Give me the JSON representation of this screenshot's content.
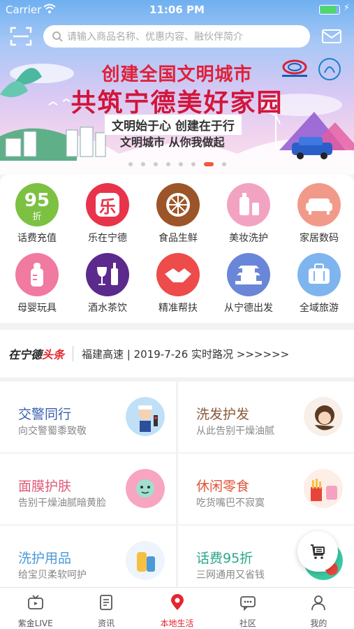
{
  "status_bar": {
    "carrier": "Carrier",
    "time": "11:06 PM",
    "battery_level": 0.85
  },
  "search": {
    "placeholder": "请输入商品名称、优惠内容、融伙伴简介"
  },
  "banner": {
    "title_line1": "创建全国文明城市",
    "title_line2": "共筑宁德美好家园",
    "subtitle_line1": "文明始于心  创建在于行",
    "subtitle_line2": "文明城市  从你我做起",
    "slide_count": 8,
    "active_slide": 6
  },
  "categories": [
    {
      "label": "话费充值",
      "icon": "phone-credit-95-icon",
      "badge": "95",
      "badge_sub": "折",
      "color": "#7cc142"
    },
    {
      "label": "乐在宁德",
      "icon": "le-icon",
      "badge": "乐",
      "color": "#e8334a"
    },
    {
      "label": "食品生鲜",
      "icon": "orange-slice-icon",
      "color": "#9c5528"
    },
    {
      "label": "美妆洗护",
      "icon": "cosmetics-icon",
      "color": "#f3a3c2"
    },
    {
      "label": "家居数码",
      "icon": "sofa-icon",
      "color": "#f29a8a"
    },
    {
      "label": "母婴玩具",
      "icon": "baby-bottle-icon",
      "color": "#f07aa0"
    },
    {
      "label": "酒水茶饮",
      "icon": "wine-icon",
      "color": "#5b2a8c"
    },
    {
      "label": "精准帮扶",
      "icon": "handshake-icon",
      "color": "#ee4b4b"
    },
    {
      "label": "从宁德出发",
      "icon": "pagoda-icon",
      "color": "#6a86d8"
    },
    {
      "label": "全域旅游",
      "icon": "luggage-icon",
      "color": "#7fb5ee"
    }
  ],
  "ticker": {
    "brand_black": "在宁德",
    "brand_red": "头条",
    "headline": "福建高速 | 2019-7-26 实时路况 >>>>>>"
  },
  "promos": [
    {
      "title": "交警同行",
      "subtitle": "向交警蜀黍致敬",
      "title_color": "#3a5fb0",
      "icon": "traffic-police-icon"
    },
    {
      "title": "洗发护发",
      "subtitle": "从此告别干燥油腻",
      "title_color": "#8a5a3c",
      "icon": "hair-care-icon"
    },
    {
      "title": "面膜护肤",
      "subtitle": "告别干燥油腻暗黄脸",
      "title_color": "#e05a78",
      "icon": "face-mask-icon"
    },
    {
      "title": "休闲零食",
      "subtitle": "吃货嘴巴不寂寞",
      "title_color": "#e0533a",
      "icon": "snacks-icon"
    },
    {
      "title": "洗护用品",
      "subtitle": "给宝贝柔软呵护",
      "title_color": "#4a9ad8",
      "icon": "baby-care-icon"
    },
    {
      "title": "话费95折",
      "subtitle": "三网通用又省钱",
      "title_color": "#2ca58a",
      "icon": "phone-discount-icon"
    }
  ],
  "tabs": [
    {
      "label": "紫金LIVE",
      "icon": "tv-icon",
      "active": false
    },
    {
      "label": "资讯",
      "icon": "news-icon",
      "active": false
    },
    {
      "label": "本地生活",
      "icon": "location-pin-icon",
      "active": true
    },
    {
      "label": "社区",
      "icon": "chat-bubble-icon",
      "active": false
    },
    {
      "label": "我的",
      "icon": "person-icon",
      "active": false
    }
  ],
  "colors": {
    "accent": "#e3262f",
    "active_dot": "#f05a3c"
  }
}
